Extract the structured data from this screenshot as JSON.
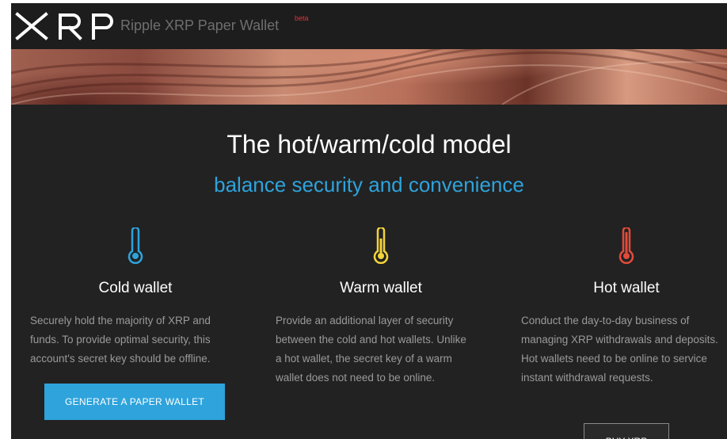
{
  "header": {
    "logo_text": "XRP",
    "brand": "Ripple XRP Paper Wallet",
    "badge": "beta"
  },
  "hero": {
    "title": "The hot/warm/cold model",
    "subtitle": "balance security and convenience"
  },
  "wallets": [
    {
      "title": "Cold wallet",
      "icon": "thermometer-cold-icon",
      "color": "#2ea3dc",
      "lines": [
        "Securely hold the majority of XRP and",
        "funds. To provide optimal security, this",
        "account's secret key should be offline."
      ]
    },
    {
      "title": "Warm wallet",
      "icon": "thermometer-warm-icon",
      "color": "#f3d33a",
      "lines": [
        "Provide an additional layer of security",
        "between the cold and hot wallets. Unlike",
        "a hot wallet, the secret key of a warm",
        "wallet does not need to be online."
      ]
    },
    {
      "title": "Hot wallet",
      "icon": "thermometer-hot-icon",
      "color": "#e24a3b",
      "lines": [
        "Conduct the day-to-day business of",
        "managing XRP withdrawals and deposits.",
        "Hot wallets need to be online to service",
        "instant withdrawal requests."
      ]
    }
  ],
  "buttons": {
    "generate": "GENERATE A PAPER WALLET",
    "buy": "BUY XRP"
  },
  "colors": {
    "accent": "#2ea3dc",
    "background": "#222222"
  }
}
